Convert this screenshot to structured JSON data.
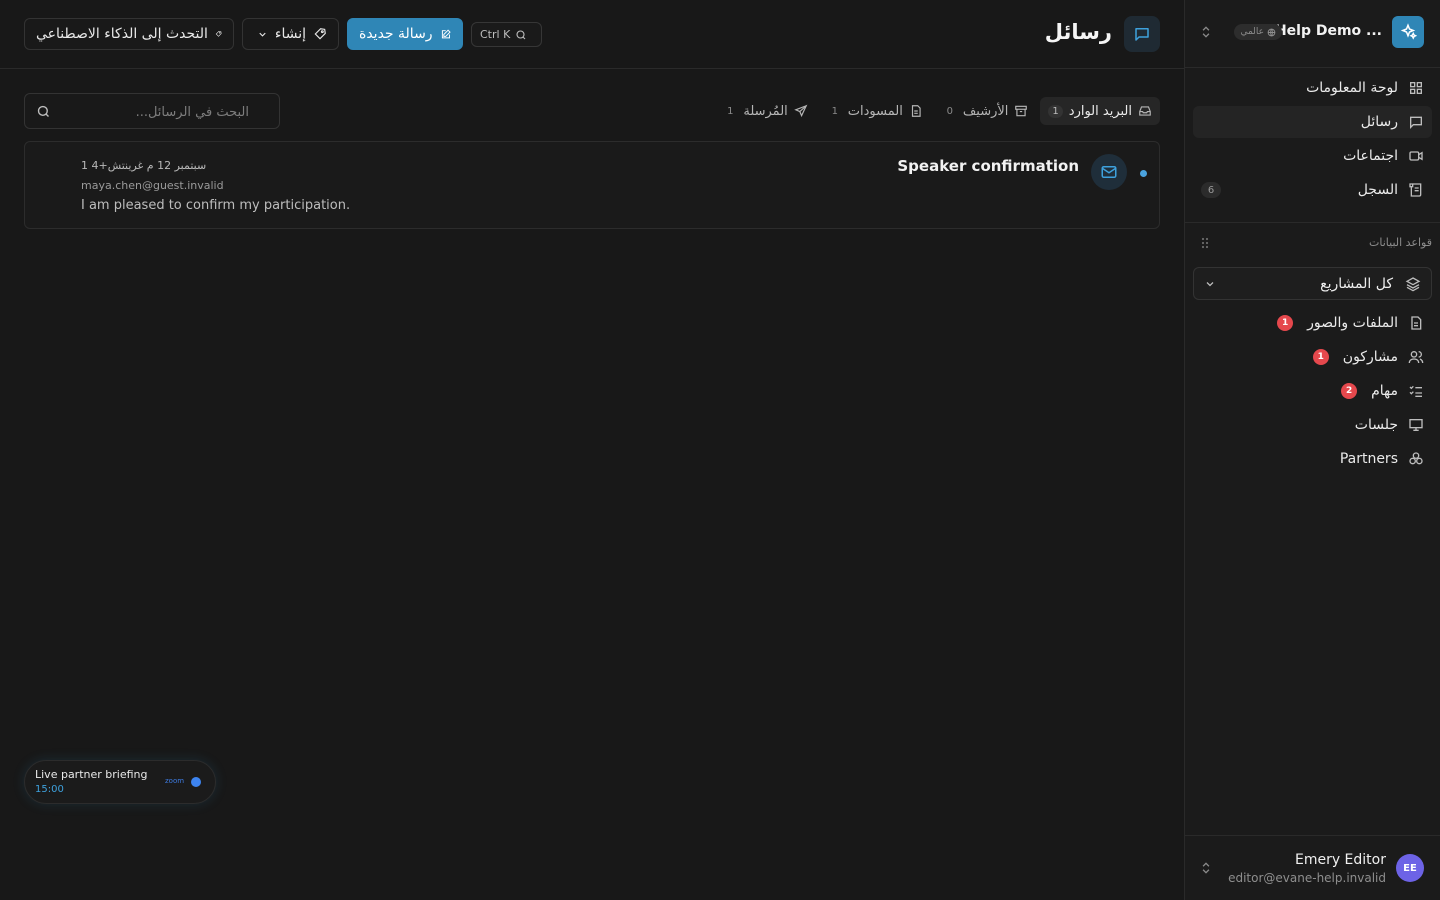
{
  "workspace": {
    "name": "Help Demo ...",
    "badge": "عالمي"
  },
  "sidebar": {
    "nav": [
      {
        "label": "لوحة المعلومات",
        "icon": "dashboard-icon"
      },
      {
        "label": "رسائل",
        "icon": "message-icon",
        "active": true
      },
      {
        "label": "اجتماعات",
        "icon": "video-icon"
      },
      {
        "label": "السجل",
        "icon": "log-icon",
        "count": "6"
      }
    ],
    "section_title": "قواعد البيانات",
    "project_select": "كل المشاريع",
    "databases": [
      {
        "label": "الملفات والصور",
        "icon": "file-icon",
        "badge": "1"
      },
      {
        "label": "مشاركون",
        "icon": "users-icon",
        "badge": "1"
      },
      {
        "label": "مهام",
        "icon": "tasks-icon",
        "badge": "2"
      },
      {
        "label": "جلسات",
        "icon": "presentation-icon"
      },
      {
        "label": "Partners",
        "icon": "partners-icon"
      }
    ]
  },
  "user": {
    "initials": "EE",
    "name": "Emery Editor",
    "email": "editor@evane-help.invalid"
  },
  "header": {
    "title": "رسائل",
    "ai_button": "التحدث إلى الذكاء الاصطناعي",
    "create_button": "إنشاء",
    "new_message_button": "رسالة جديدة",
    "search_shortcut": "Ctrl K"
  },
  "tabs": [
    {
      "label": "البريد الوارد",
      "count": "1",
      "active": true
    },
    {
      "label": "الأرشيف",
      "count": "0"
    },
    {
      "label": "المسودات",
      "count": "1"
    },
    {
      "label": "المُرسلة",
      "count": "1"
    }
  ],
  "search": {
    "placeholder": "البحث في الرسائل..."
  },
  "messages": [
    {
      "subject": "Speaker confirmation",
      "date": "1 سبتمبر 12 م غرينتش+4",
      "from": "maya.chen@guest.invalid",
      "preview": "I am pleased to confirm my participation."
    }
  ],
  "live_meeting": {
    "title": "Live partner briefing",
    "time": "15:00",
    "provider": "zoom"
  },
  "colors": {
    "accent": "#2f86b6",
    "badge_red": "#e5484d",
    "avatar": "#6d63e6"
  }
}
